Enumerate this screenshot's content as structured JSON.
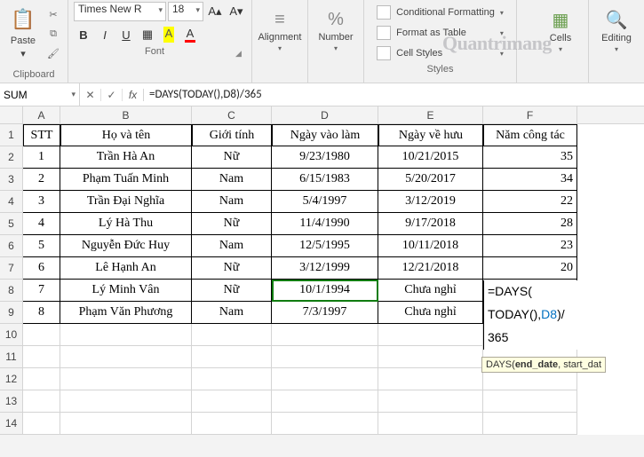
{
  "ribbon": {
    "clipboard": {
      "label": "Clipboard",
      "paste": "Paste"
    },
    "font": {
      "label": "Font",
      "family": "Times New R",
      "size": "18",
      "bold": "B",
      "italic": "I",
      "underline": "U"
    },
    "alignment": {
      "label": "Alignment"
    },
    "number": {
      "label": "Number"
    },
    "styles": {
      "label": "Styles",
      "cond": "Conditional Formatting",
      "table": "Format as Table",
      "cstyles": "Cell Styles"
    },
    "cells": {
      "label": "Cells"
    },
    "editing": {
      "label": "Editing"
    }
  },
  "namebox": "SUM",
  "formula": "=DAYS(TODAY(),D8)/365",
  "columns": [
    "A",
    "B",
    "C",
    "D",
    "E",
    "F"
  ],
  "headers": {
    "stt": "STT",
    "name": "Họ và tên",
    "gender": "Giới tính",
    "start": "Ngày vào làm",
    "retire": "Ngày về hưu",
    "years": "Năm công tác"
  },
  "rows": [
    {
      "n": "1",
      "name": "Trần Hà An",
      "g": "Nữ",
      "s": "9/23/1980",
      "r": "10/21/2015",
      "y": "35"
    },
    {
      "n": "2",
      "name": "Phạm Tuấn Minh",
      "g": "Nam",
      "s": "6/15/1983",
      "r": "5/20/2017",
      "y": "34"
    },
    {
      "n": "3",
      "name": "Trần Đại Nghĩa",
      "g": "Nam",
      "s": "5/4/1997",
      "r": "3/12/2019",
      "y": "22"
    },
    {
      "n": "4",
      "name": "Lý Hà Thu",
      "g": "Nữ",
      "s": "11/4/1990",
      "r": "9/17/2018",
      "y": "28"
    },
    {
      "n": "5",
      "name": "Nguyễn Đức Huy",
      "g": "Nam",
      "s": "12/5/1995",
      "r": "10/11/2018",
      "y": "23"
    },
    {
      "n": "6",
      "name": "Lê Hạnh An",
      "g": "Nữ",
      "s": "3/12/1999",
      "r": "12/21/2018",
      "y": "20"
    },
    {
      "n": "7",
      "name": "Lý Minh Vân",
      "g": "Nữ",
      "s": "10/1/1994",
      "r": "Chưa nghỉ",
      "y": ""
    },
    {
      "n": "8",
      "name": "Phạm Văn Phương",
      "g": "Nam",
      "s": "7/3/1997",
      "r": "Chưa nghỉ",
      "y": ""
    }
  ],
  "editing": {
    "line1_a": "=DAYS(",
    "line2_a": "TODAY",
    "line2_b": "()",
    "line2_c": ",",
    "line2_d": "D8",
    "line2_e": ")/",
    "line3": "365"
  },
  "tooltip_a": "DAYS(",
  "tooltip_b": "end_date",
  "tooltip_c": ", start_dat",
  "watermark": "Quantrimang"
}
